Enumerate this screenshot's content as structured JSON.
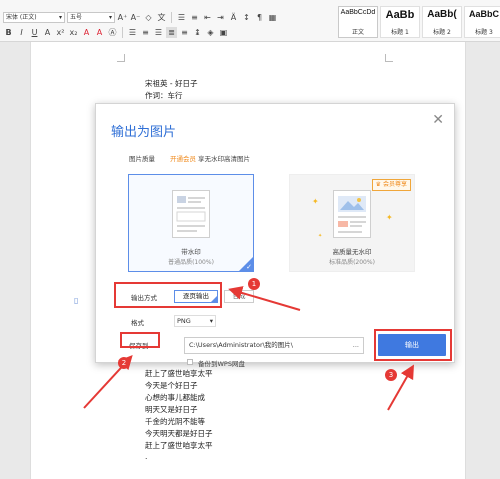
{
  "ribbon": {
    "font_name": "宋体 (正文)",
    "font_size": "五号",
    "styles": [
      {
        "sample": "AaBbCcDd",
        "name": "正文"
      },
      {
        "sample": "AaBb",
        "name": "标题 1"
      },
      {
        "sample": "AaBb(",
        "name": "标题 2"
      },
      {
        "sample": "AaBbC",
        "name": "标题 3"
      }
    ]
  },
  "document": {
    "lines_top": [
      "宋祖英 - 好日子",
      "作词：车行"
    ],
    "lines_bottom": [
      "赶上了盛世咱享太平",
      "今天是个好日子",
      "心想的事儿都能成",
      "明天又是好日子",
      "千金的光阴不能等",
      "今天明天都是好日子",
      "赶上了盛世咱享太平",
      "."
    ]
  },
  "dialog": {
    "title": "输出为图片",
    "quality_label": "图片质量",
    "vip_link": "开通会员",
    "vip_desc": "享无水印高清图片",
    "option_watermark": {
      "label": "带水印",
      "sub": "普通品质(100%)"
    },
    "option_premium": {
      "label": "高质量无水印",
      "sub": "标准品质(200%)",
      "badge": "会员尊享"
    },
    "mode_label": "输出方式",
    "mode_value": "逐页输出",
    "mode_other": "合成",
    "format_label": "格式",
    "format_value": "PNG",
    "save_label": "保存到",
    "save_path": "C:\\Users\\Administrator\\我的图片\\",
    "path_more": "...",
    "cloud_label": "备份到WPS网盘",
    "export_button": "输出"
  },
  "annotations": [
    "1",
    "2",
    "3"
  ],
  "colors": {
    "accent": "#3f79e0",
    "annotation": "#e53935",
    "vip": "#f08a1c"
  }
}
